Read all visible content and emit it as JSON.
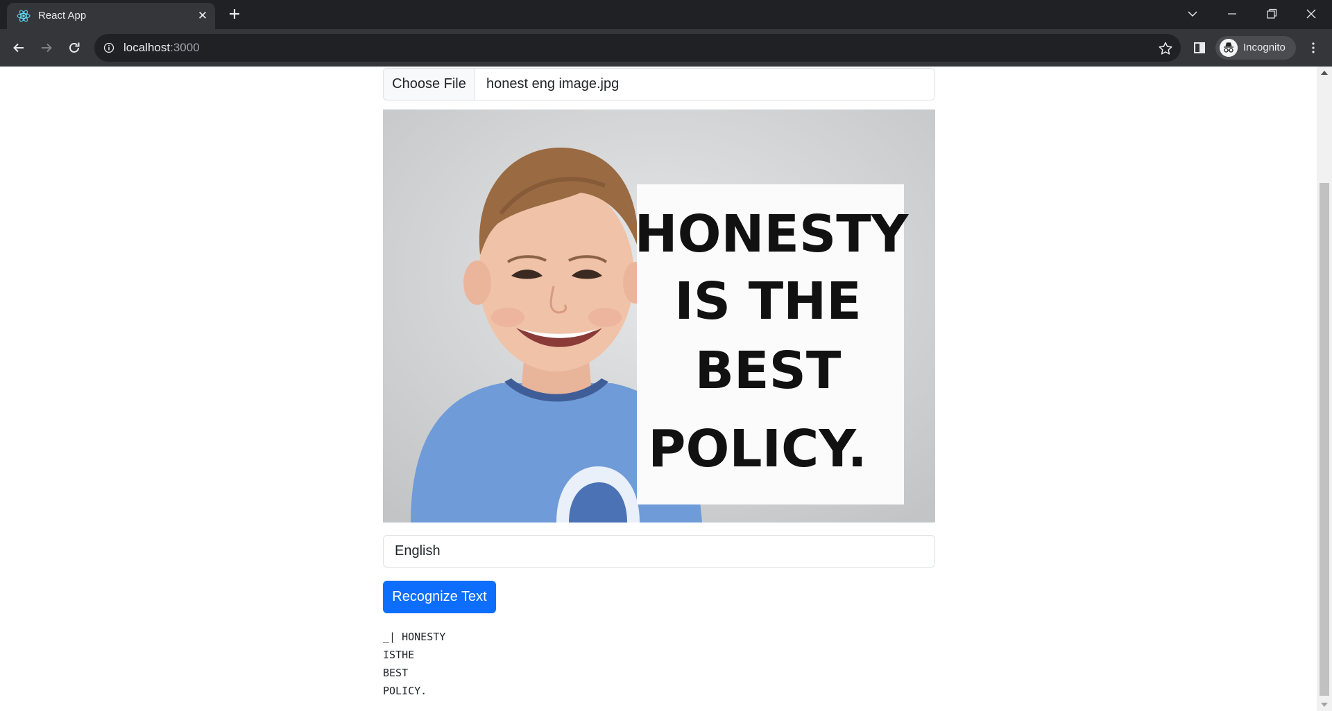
{
  "browser": {
    "tab_title": "React App",
    "url_host": "localhost",
    "url_port": ":3000",
    "profile_label": "Incognito",
    "icons": [
      "react-logo-icon",
      "close-icon",
      "plus-icon",
      "chevron-down-icon",
      "minimize-icon",
      "restore-icon",
      "back-icon",
      "forward-icon",
      "reload-icon",
      "info-icon",
      "star-icon",
      "side-panel-icon",
      "incognito-icon",
      "kebab-menu-icon"
    ]
  },
  "page": {
    "file_input": {
      "button_label": "Choose File",
      "file_name": "honest eng image.jpg"
    },
    "preview": {
      "poster_lines": [
        "HONESTY",
        "IS THE",
        "BEST",
        "POLICY."
      ]
    },
    "language": {
      "selected": "English"
    },
    "recognize_button": "Recognize Text",
    "result_lines": [
      "_| HONESTY",
      "ISTHE",
      "BEST",
      "POLICY."
    ]
  },
  "colors": {
    "primary": "#0d6efd",
    "chrome_dark": "#202124",
    "chrome_toolbar": "#35363a",
    "shirt_blue": "#6f9bd8"
  }
}
